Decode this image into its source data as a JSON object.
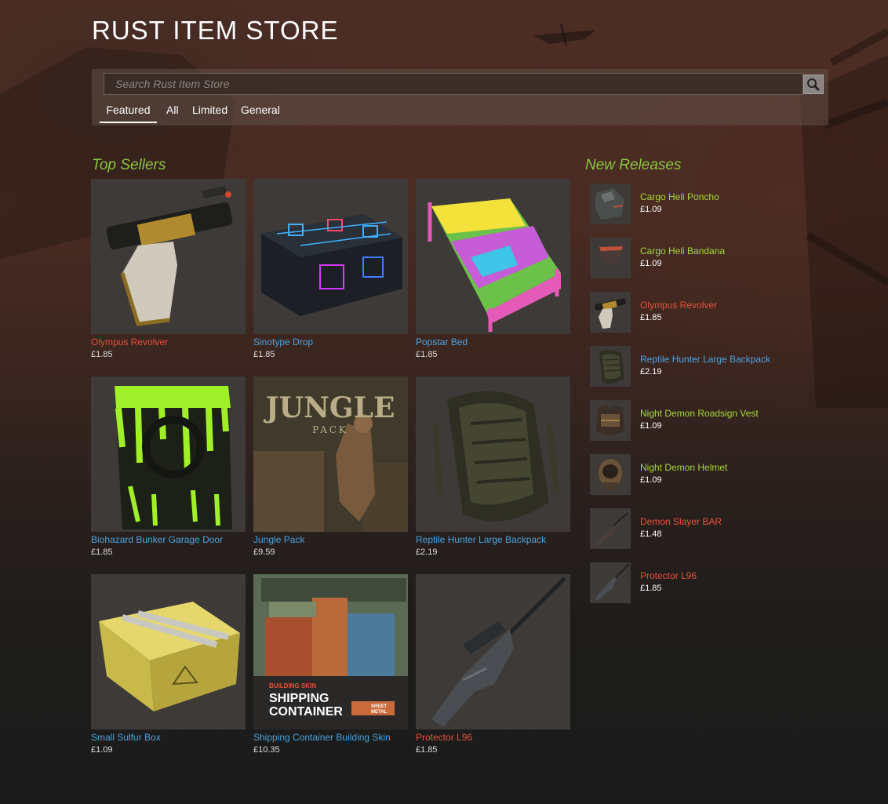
{
  "page": {
    "title": "RUST ITEM STORE"
  },
  "search": {
    "placeholder": "Search Rust Item Store"
  },
  "tabs": [
    {
      "label": "Featured",
      "active": true
    },
    {
      "label": "All"
    },
    {
      "label": "Limited"
    },
    {
      "label": "General"
    }
  ],
  "colors": {
    "rarity_red": "#e8503a",
    "rarity_blue": "#4aa3df",
    "rarity_green": "#a4d93a",
    "section_title": "#8bc53f"
  },
  "top_sellers": {
    "title": "Top Sellers",
    "items": [
      {
        "name": "Olympus Revolver",
        "price": "£1.85",
        "color": "red",
        "icon": "revolver-icon"
      },
      {
        "name": "Sinotype Drop",
        "price": "£1.85",
        "color": "blue",
        "icon": "crate-icon"
      },
      {
        "name": "Popstar Bed",
        "price": "£1.85",
        "color": "blue",
        "icon": "bed-icon"
      },
      {
        "name": "Biohazard Bunker Garage Door",
        "price": "£1.85",
        "color": "blue",
        "icon": "garage-door-icon"
      },
      {
        "name": "Jungle Pack",
        "price": "£9.59",
        "color": "blue",
        "icon": "bundle-icon",
        "art_title": "JUNGLE",
        "art_subtitle": "PACK"
      },
      {
        "name": "Reptile Hunter Large Backpack",
        "price": "£2.19",
        "color": "blue",
        "icon": "backpack-icon"
      },
      {
        "name": "Small Sulfur Box",
        "price": "£1.09",
        "color": "blue",
        "icon": "box-icon"
      },
      {
        "name": "Shipping Container Building Skin",
        "price": "£10.35",
        "color": "blue",
        "icon": "building-icon",
        "art_kicker": "BUILDING SKIN",
        "art_title_1": "SHIPPING",
        "art_title_2": "CONTAINER",
        "art_badge_1": "SHEET",
        "art_badge_2": "METAL"
      },
      {
        "name": "Protector L96",
        "price": "£1.85",
        "color": "red",
        "icon": "rifle-icon"
      }
    ]
  },
  "new_releases": {
    "title": "New Releases",
    "items": [
      {
        "name": "Cargo Heli Poncho",
        "price": "£1.09",
        "color": "green",
        "icon": "poncho-icon"
      },
      {
        "name": "Cargo Heli Bandana",
        "price": "£1.09",
        "color": "green",
        "icon": "bandana-icon"
      },
      {
        "name": "Olympus Revolver",
        "price": "£1.85",
        "color": "red",
        "icon": "revolver-icon"
      },
      {
        "name": "Reptile Hunter Large Backpack",
        "price": "£2.19",
        "color": "blue",
        "icon": "backpack-icon"
      },
      {
        "name": "Night Demon Roadsign Vest",
        "price": "£1.09",
        "color": "green",
        "icon": "vest-icon"
      },
      {
        "name": "Night Demon Helmet",
        "price": "£1.09",
        "color": "green",
        "icon": "helmet-icon"
      },
      {
        "name": "Demon Slayer BAR",
        "price": "£1.48",
        "color": "red",
        "icon": "rifle-icon"
      },
      {
        "name": "Protector L96",
        "price": "£1.85",
        "color": "red",
        "icon": "rifle-icon"
      }
    ]
  }
}
